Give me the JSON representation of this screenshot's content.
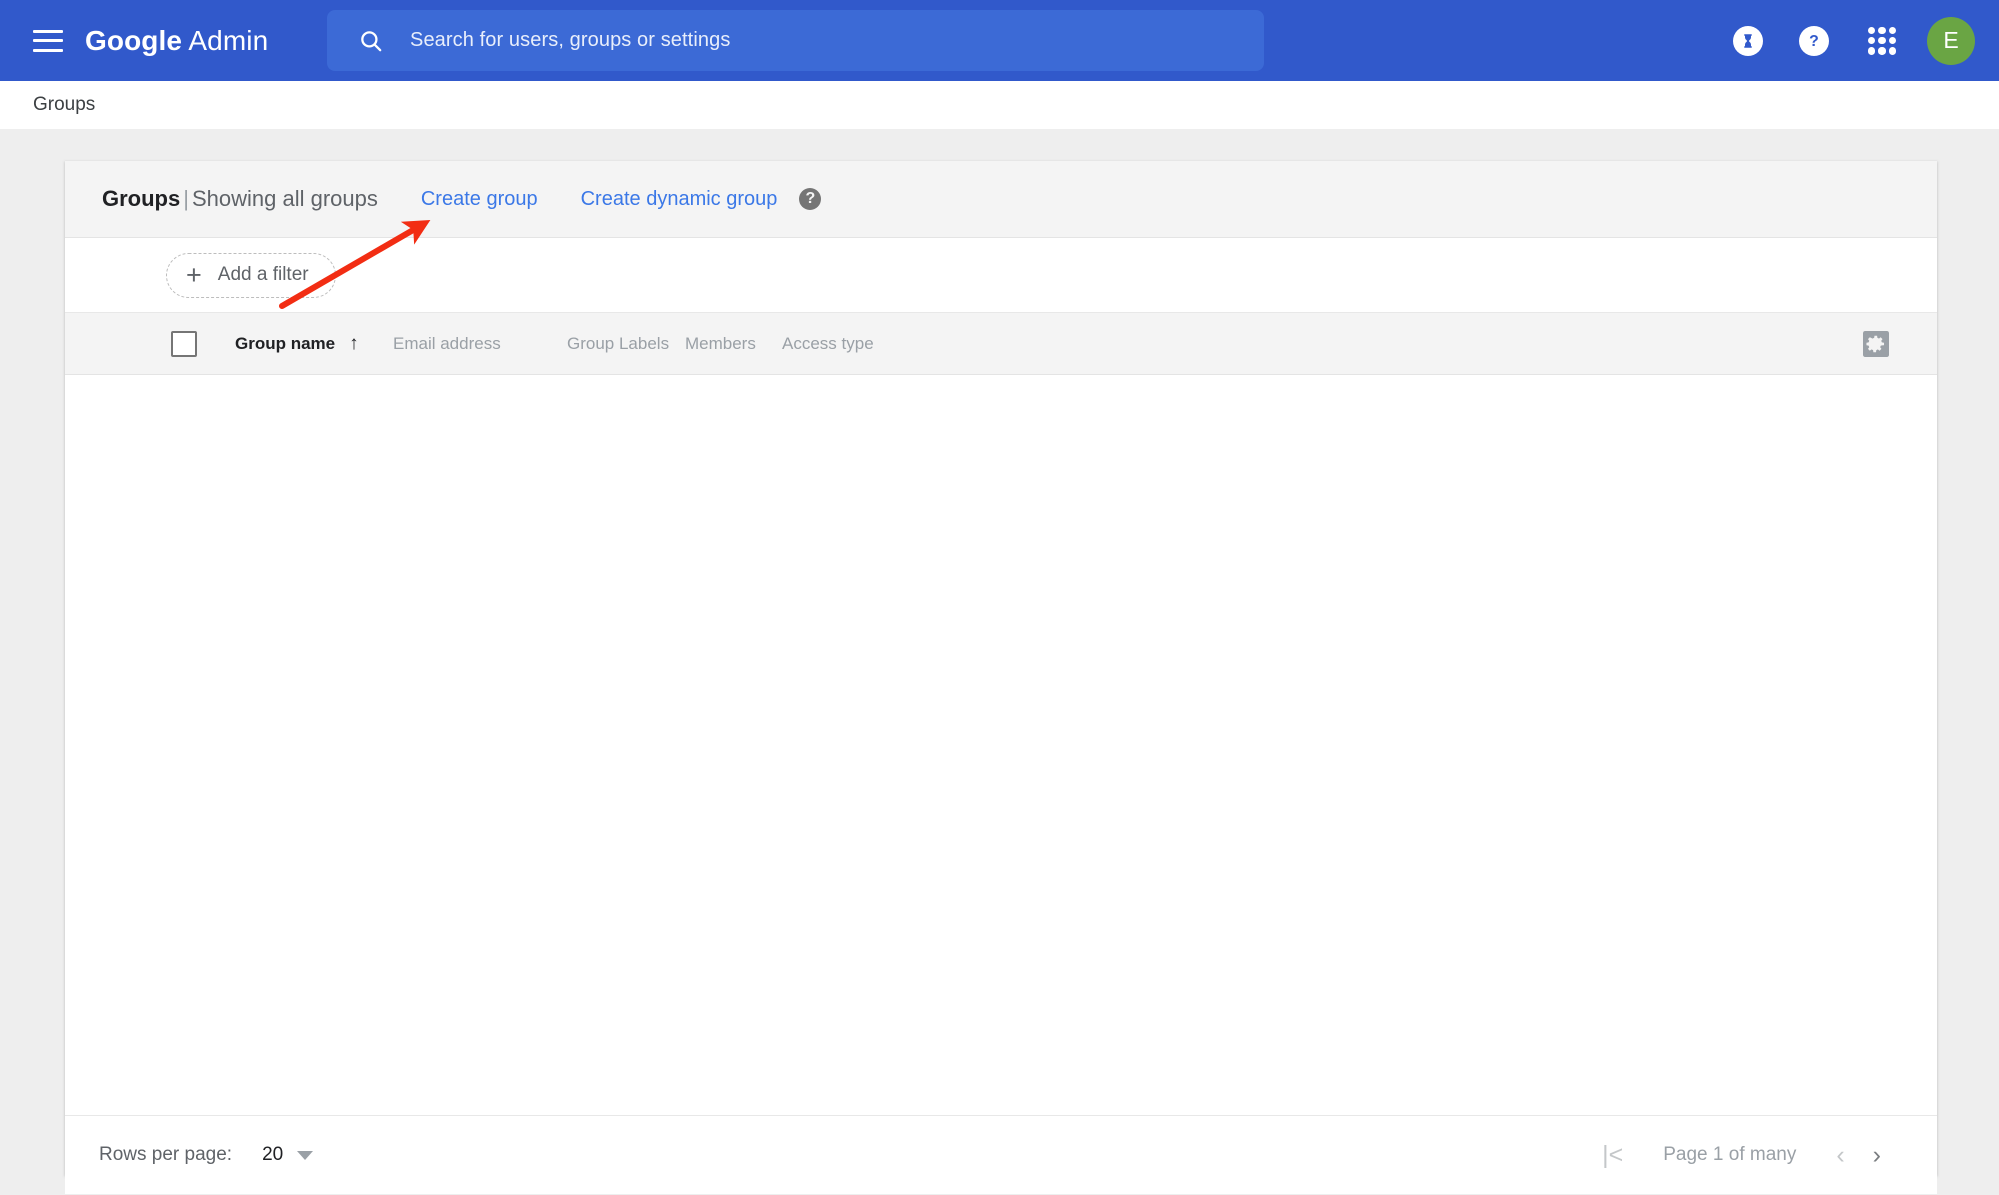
{
  "appbar": {
    "menu_icon": "hamburger-menu-icon",
    "brand_bold": "Google",
    "brand_light": " Admin",
    "search": {
      "icon": "search-icon",
      "placeholder": "Search for users, groups or settings",
      "value": ""
    },
    "trial_icon": "hourglass-icon",
    "help_icon": "question-mark-icon",
    "apps_icon": "apps-grid-icon",
    "avatar_initial": "E",
    "avatar_color": "#6aa544",
    "bar_color": "#3159cb",
    "search_box_color": "#3c6ad6"
  },
  "breadcrumb": {
    "label": "Groups"
  },
  "card": {
    "header": {
      "title_bold": "Groups",
      "title_separator": "|",
      "title_rest": "Showing all groups",
      "create_group_label": "Create group",
      "create_dynamic_group_label": "Create dynamic group",
      "help_badge": "?",
      "link_color": "#3b78e7"
    },
    "filter": {
      "plus_icon": "plus-icon",
      "label": "Add a filter"
    },
    "table": {
      "select_all_checkbox": "unchecked",
      "columns": [
        {
          "label": "Group name",
          "sorted": true,
          "sort_icon": "↑"
        },
        {
          "label": "Email address",
          "sorted": false,
          "sort_icon": ""
        },
        {
          "label": "Group Labels",
          "sorted": false,
          "sort_icon": ""
        },
        {
          "label": "Members",
          "sorted": false,
          "sort_icon": ""
        },
        {
          "label": "Access type",
          "sorted": false,
          "sort_icon": ""
        }
      ],
      "settings_icon": "gear-icon",
      "rows": []
    },
    "pagination": {
      "rows_per_page_label": "Rows per page:",
      "rows_per_page_value": "20",
      "first_page_icon": "|<",
      "prev_page_icon": "‹",
      "page_info": "Page 1 of many",
      "next_page_icon": "›"
    }
  },
  "annotation": {
    "arrow_color": "#f22d13",
    "points_to": "Create group"
  }
}
